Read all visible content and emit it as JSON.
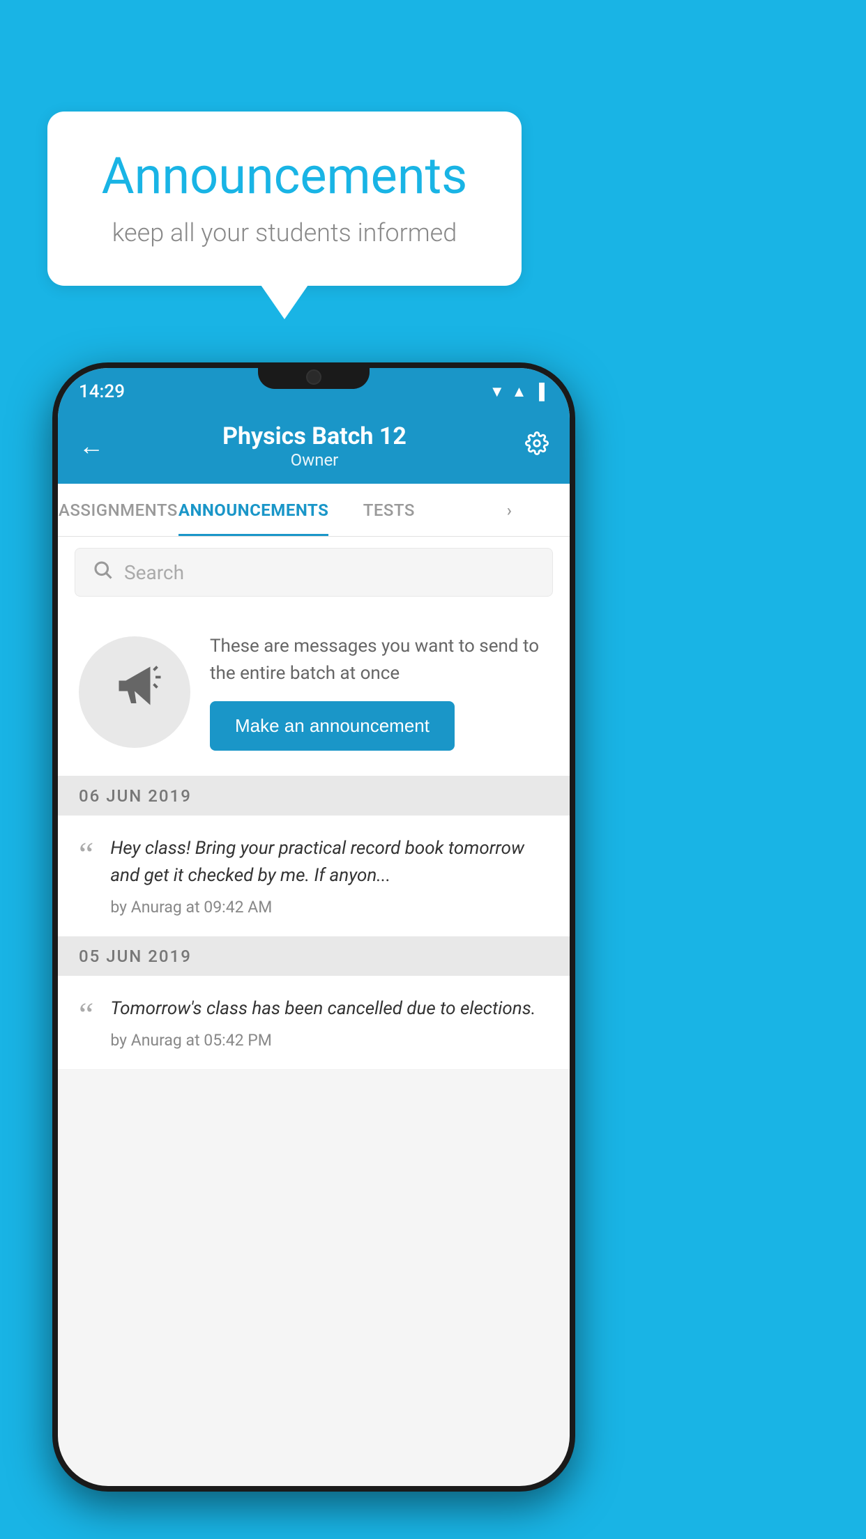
{
  "background_color": "#19B4E5",
  "speech_bubble": {
    "title": "Announcements",
    "subtitle": "keep all your students informed"
  },
  "phone": {
    "status_bar": {
      "time": "14:29",
      "wifi": "▼",
      "signal": "▲",
      "battery": "▐"
    },
    "header": {
      "title": "Physics Batch 12",
      "subtitle": "Owner",
      "back_label": "←",
      "gear_label": "⚙"
    },
    "tabs": [
      {
        "label": "ASSIGNMENTS",
        "active": false
      },
      {
        "label": "ANNOUNCEMENTS",
        "active": true
      },
      {
        "label": "TESTS",
        "active": false
      },
      {
        "label": "·",
        "active": false
      }
    ],
    "search": {
      "placeholder": "Search"
    },
    "announcement_prompt": {
      "description_text": "These are messages you want to send to the entire batch at once",
      "button_label": "Make an announcement"
    },
    "date_sections": [
      {
        "date": "06  JUN  2019",
        "items": [
          {
            "text": "Hey class! Bring your practical record book tomorrow and get it checked by me. If anyon...",
            "meta": "by Anurag at 09:42 AM"
          }
        ]
      },
      {
        "date": "05  JUN  2019",
        "items": [
          {
            "text": "Tomorrow's class has been cancelled due to elections.",
            "meta": "by Anurag at 05:42 PM"
          }
        ]
      }
    ]
  }
}
